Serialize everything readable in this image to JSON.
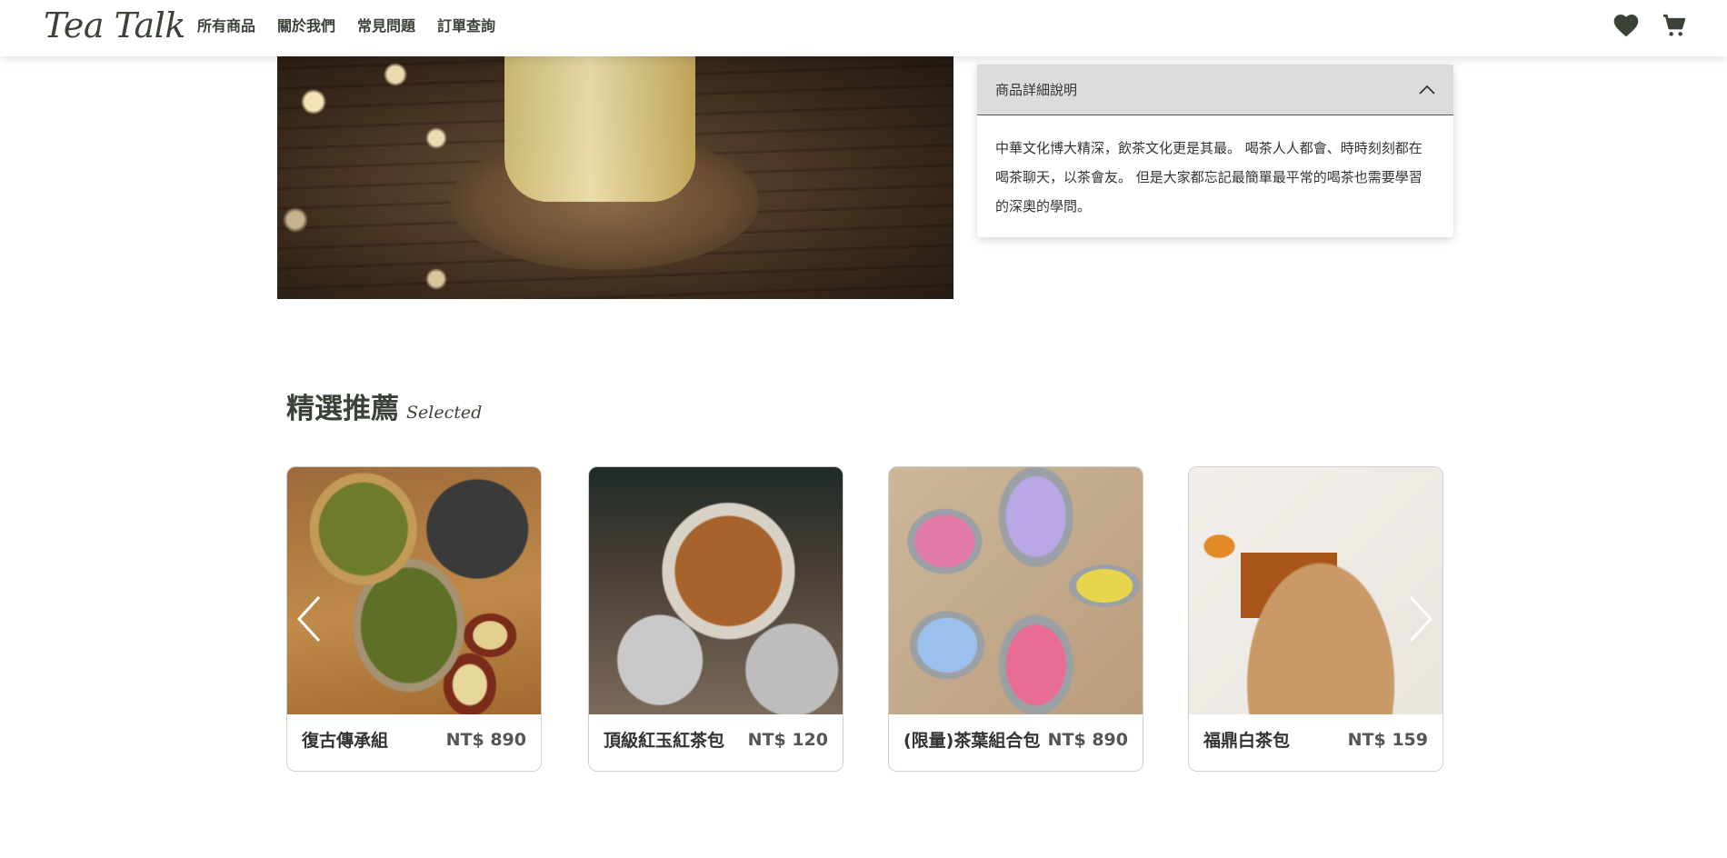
{
  "brand": {
    "logo": "Tea Talk",
    "accent_color": "#3b4237"
  },
  "nav": [
    {
      "label": "所有商品"
    },
    {
      "label": "關於我們"
    },
    {
      "label": "常見問題"
    },
    {
      "label": "訂單查詢"
    }
  ],
  "header_icons": {
    "favorite": "heart-icon",
    "cart": "cart-icon"
  },
  "details": {
    "title": "商品詳細說明",
    "body": "中華文化博大精深，飲茶文化更是其最。 喝茶人人都會、時時刻刻都在喝茶聊天，以茶會友。 但是大家都忘記最簡單最平常的喝茶也需要學習的深奧的學問。",
    "expanded": true
  },
  "recommend": {
    "title_zh": "精選推薦",
    "title_en": "Selected",
    "products": [
      {
        "name": "復古傳承組",
        "price": "NT$ 890"
      },
      {
        "name": "頂級紅玉紅茶包",
        "price": "NT$ 120"
      },
      {
        "name": "(限量)茶葉組合包",
        "price": "NT$ 890"
      },
      {
        "name": "福鼎白茶包",
        "price": "NT$ 159"
      }
    ]
  }
}
